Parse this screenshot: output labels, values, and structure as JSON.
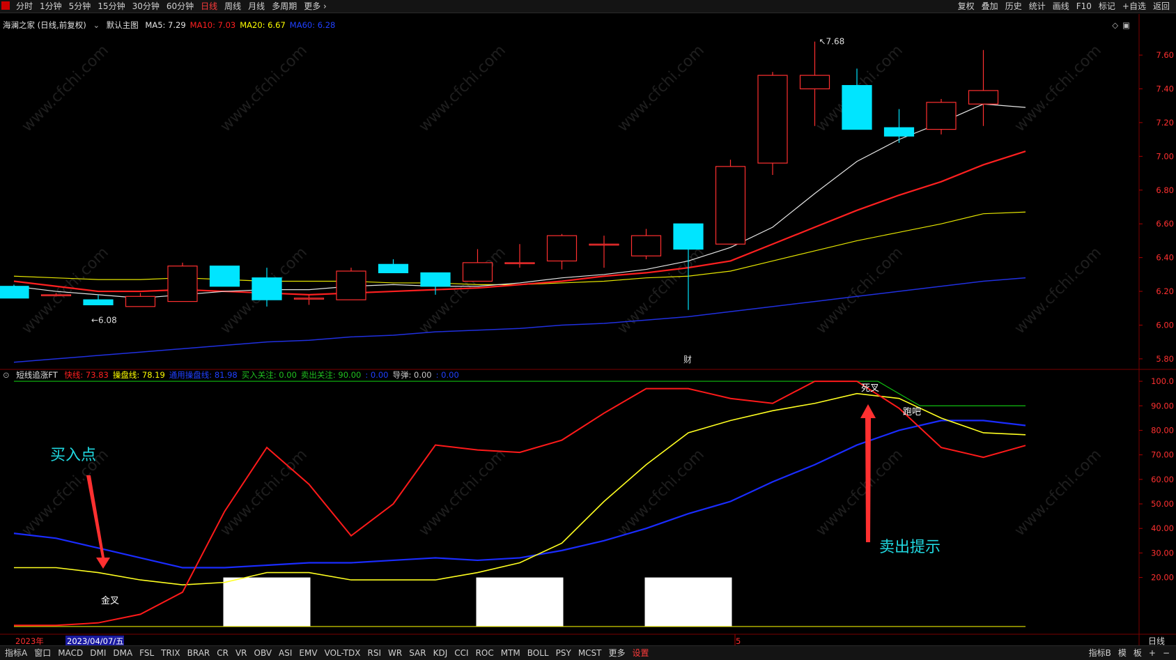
{
  "toolbar": {
    "periods": [
      "分时",
      "1分钟",
      "5分钟",
      "15分钟",
      "30分钟",
      "60分钟",
      "日线",
      "周线",
      "月线",
      "多周期",
      "更多 ›"
    ],
    "active_period": "日线",
    "right_actions": [
      "复权",
      "叠加",
      "历史",
      "统计",
      "画线",
      "F10",
      "标记",
      "+自选",
      "返回"
    ]
  },
  "main_chart": {
    "title": "海澜之家 (日线,前复权)",
    "subtitle": "默认主图",
    "ma_labels": [
      {
        "text": "MA5: 7.29",
        "color": "#e6e6e6"
      },
      {
        "text": "MA10: 7.03",
        "color": "#ff2020"
      },
      {
        "text": "MA20: 6.67",
        "color": "#ffff00"
      },
      {
        "text": "MA60: 6.28",
        "color": "#2040ff"
      }
    ],
    "y_ticks": [
      "7.60",
      "7.40",
      "7.20",
      "7.00",
      "6.80",
      "6.60",
      "6.40",
      "6.20",
      "6.00",
      "5.80"
    ],
    "ylim": [
      5.75,
      7.72
    ],
    "high_label": "7.68",
    "low_label": "6.08",
    "event_marker": "财",
    "candles": [
      {
        "o": 6.23,
        "h": 6.24,
        "l": 6.16,
        "c": 6.16
      },
      {
        "o": 6.18,
        "h": 6.19,
        "l": 6.17,
        "c": 6.18
      },
      {
        "o": 6.15,
        "h": 6.18,
        "l": 6.12,
        "c": 6.12
      },
      {
        "o": 6.11,
        "h": 6.19,
        "l": 6.11,
        "c": 6.17
      },
      {
        "o": 6.14,
        "h": 6.37,
        "l": 6.14,
        "c": 6.35
      },
      {
        "o": 6.35,
        "h": 6.35,
        "l": 6.23,
        "c": 6.23
      },
      {
        "o": 6.28,
        "h": 6.34,
        "l": 6.11,
        "c": 6.15
      },
      {
        "o": 6.16,
        "h": 6.18,
        "l": 6.12,
        "c": 6.16
      },
      {
        "o": 6.15,
        "h": 6.34,
        "l": 6.15,
        "c": 6.32
      },
      {
        "o": 6.36,
        "h": 6.39,
        "l": 6.31,
        "c": 6.31
      },
      {
        "o": 6.31,
        "h": 6.31,
        "l": 6.18,
        "c": 6.23
      },
      {
        "o": 6.26,
        "h": 6.45,
        "l": 6.26,
        "c": 6.37
      },
      {
        "o": 6.37,
        "h": 6.48,
        "l": 6.34,
        "c": 6.37
      },
      {
        "o": 6.38,
        "h": 6.54,
        "l": 6.33,
        "c": 6.53
      },
      {
        "o": 6.48,
        "h": 6.53,
        "l": 6.34,
        "c": 6.48
      },
      {
        "o": 6.41,
        "h": 6.57,
        "l": 6.39,
        "c": 6.53
      },
      {
        "o": 6.6,
        "h": 6.6,
        "l": 6.09,
        "c": 6.45
      },
      {
        "o": 6.48,
        "h": 6.98,
        "l": 6.48,
        "c": 6.94
      },
      {
        "o": 6.96,
        "h": 7.5,
        "l": 6.89,
        "c": 7.48
      },
      {
        "o": 7.4,
        "h": 7.68,
        "l": 7.18,
        "c": 7.48
      },
      {
        "o": 7.42,
        "h": 7.52,
        "l": 7.16,
        "c": 7.16
      },
      {
        "o": 7.17,
        "h": 7.28,
        "l": 7.08,
        "c": 7.12
      },
      {
        "o": 7.16,
        "h": 7.34,
        "l": 7.13,
        "c": 7.32
      },
      {
        "o": 7.31,
        "h": 7.63,
        "l": 7.18,
        "c": 7.39
      }
    ],
    "ma5": [
      6.23,
      6.2,
      6.18,
      6.16,
      6.18,
      6.2,
      6.21,
      6.21,
      6.23,
      6.24,
      6.23,
      6.23,
      6.25,
      6.28,
      6.3,
      6.33,
      6.38,
      6.46,
      6.58,
      6.78,
      6.97,
      7.1,
      7.2,
      7.31,
      7.29
    ],
    "ma10": [
      6.26,
      6.23,
      6.2,
      6.2,
      6.21,
      6.2,
      6.19,
      6.18,
      6.19,
      6.2,
      6.21,
      6.22,
      6.24,
      6.26,
      6.29,
      6.31,
      6.34,
      6.38,
      6.48,
      6.58,
      6.68,
      6.77,
      6.85,
      6.95,
      7.03
    ],
    "ma20": [
      6.29,
      6.28,
      6.27,
      6.27,
      6.28,
      6.27,
      6.26,
      6.26,
      6.26,
      6.25,
      6.25,
      6.24,
      6.24,
      6.25,
      6.26,
      6.28,
      6.29,
      6.32,
      6.38,
      6.44,
      6.5,
      6.55,
      6.6,
      6.66,
      6.67
    ],
    "ma60": [
      5.78,
      5.8,
      5.82,
      5.84,
      5.86,
      5.88,
      5.9,
      5.91,
      5.93,
      5.94,
      5.96,
      5.97,
      5.98,
      6.0,
      6.01,
      6.03,
      6.05,
      6.08,
      6.11,
      6.14,
      6.17,
      6.2,
      6.23,
      6.26,
      6.28
    ]
  },
  "indicator": {
    "name": "短线追涨FT",
    "labels": [
      {
        "text": "快线: 73.83",
        "color": "#ff2020"
      },
      {
        "text": "操盘线: 78.19",
        "color": "#ffff00"
      },
      {
        "text": "通用操盘线: 81.98",
        "color": "#2040ff"
      },
      {
        "text": "买入关注: 0.00",
        "color": "#20c020"
      },
      {
        "text": "卖出关注: 90.00",
        "color": "#20c020"
      },
      {
        "text": ": 0.00",
        "color": "#2040ff"
      },
      {
        "text": "导弹: 0.00",
        "color": "#c8c8c8"
      },
      {
        "text": ": 0.00",
        "color": "#2040ff"
      }
    ],
    "y_ticks": [
      "100.0",
      "90.00",
      "80.00",
      "70.00",
      "60.00",
      "50.00",
      "40.00",
      "30.00",
      "20.00"
    ],
    "ylim": [
      -2,
      104
    ],
    "fast": [
      0.5,
      0.5,
      1.5,
      5,
      14,
      47,
      73,
      58,
      37,
      50,
      74,
      72,
      71,
      76,
      87,
      97,
      97,
      93,
      91,
      100,
      100,
      89,
      73,
      69,
      73.83
    ],
    "trade": [
      24,
      24,
      22,
      19,
      17,
      18,
      22,
      22,
      19,
      19,
      19,
      22,
      26,
      34,
      51,
      66,
      79,
      84,
      88,
      91,
      95,
      93,
      85,
      79,
      78.19
    ],
    "general": [
      38,
      36,
      32,
      28,
      24,
      24,
      25,
      26,
      26,
      27,
      28,
      27,
      28,
      31,
      35,
      40,
      46,
      51,
      59,
      66,
      74,
      80,
      84,
      84,
      81.98
    ],
    "sell_line": 90,
    "top_line": 100,
    "white_blocks": [
      [
        5,
        7
      ],
      [
        11,
        13
      ],
      [
        15,
        17
      ]
    ],
    "annotations": {
      "golden_cross": "金叉",
      "death_cross": "死叉",
      "run": "跑吧",
      "buy_point": "买入点",
      "sell_hint": "卖出提示"
    }
  },
  "date_axis": {
    "year_label": "2023年",
    "cursor_date": "2023/04/07/五",
    "month_label": "5",
    "period_label": "日线"
  },
  "bottom_toolbar": {
    "left_label": "指标A",
    "items": [
      "窗口",
      "MACD",
      "DMI",
      "DMA",
      "FSL",
      "TRIX",
      "BRAR",
      "CR",
      "VR",
      "OBV",
      "ASI",
      "EMV",
      "VOL-TDX",
      "RSI",
      "WR",
      "SAR",
      "KDJ",
      "CCI",
      "ROC",
      "MTM",
      "BOLL",
      "PSY",
      "MCST",
      "更多",
      "设置"
    ],
    "right_items": [
      "指标B",
      "模",
      "板",
      "+",
      "−"
    ]
  },
  "watermark": "www.cfchi.com",
  "colors": {
    "up": "#ff3030",
    "down": "#00e5ff",
    "ma5": "#e6e6e6",
    "ma10": "#ff2020",
    "ma20": "#e6e600",
    "ma60": "#2030e0",
    "grid": "#3a0000",
    "axis_text": "#ff3030",
    "accent_cyan": "#20d8e0"
  }
}
